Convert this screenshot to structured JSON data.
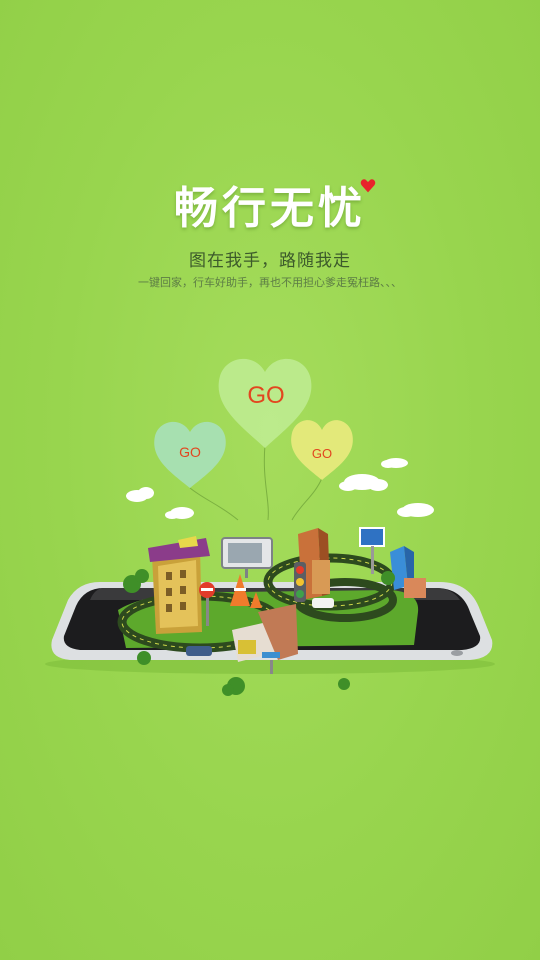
{
  "splash": {
    "title": "畅行无忧",
    "subtitle": "图在我手，路随我走",
    "tagline": "一键回家，行车好助手，再也不用担心爹走冤枉路、、、"
  },
  "hearts": [
    {
      "label": "GO",
      "color": "#bdeb8e"
    },
    {
      "label": "GO",
      "color": "#a8e0b5"
    },
    {
      "label": "GO",
      "color": "#e7ea7c"
    }
  ],
  "colors": {
    "background": "#99d64f",
    "title_heart": "#e8232b"
  }
}
